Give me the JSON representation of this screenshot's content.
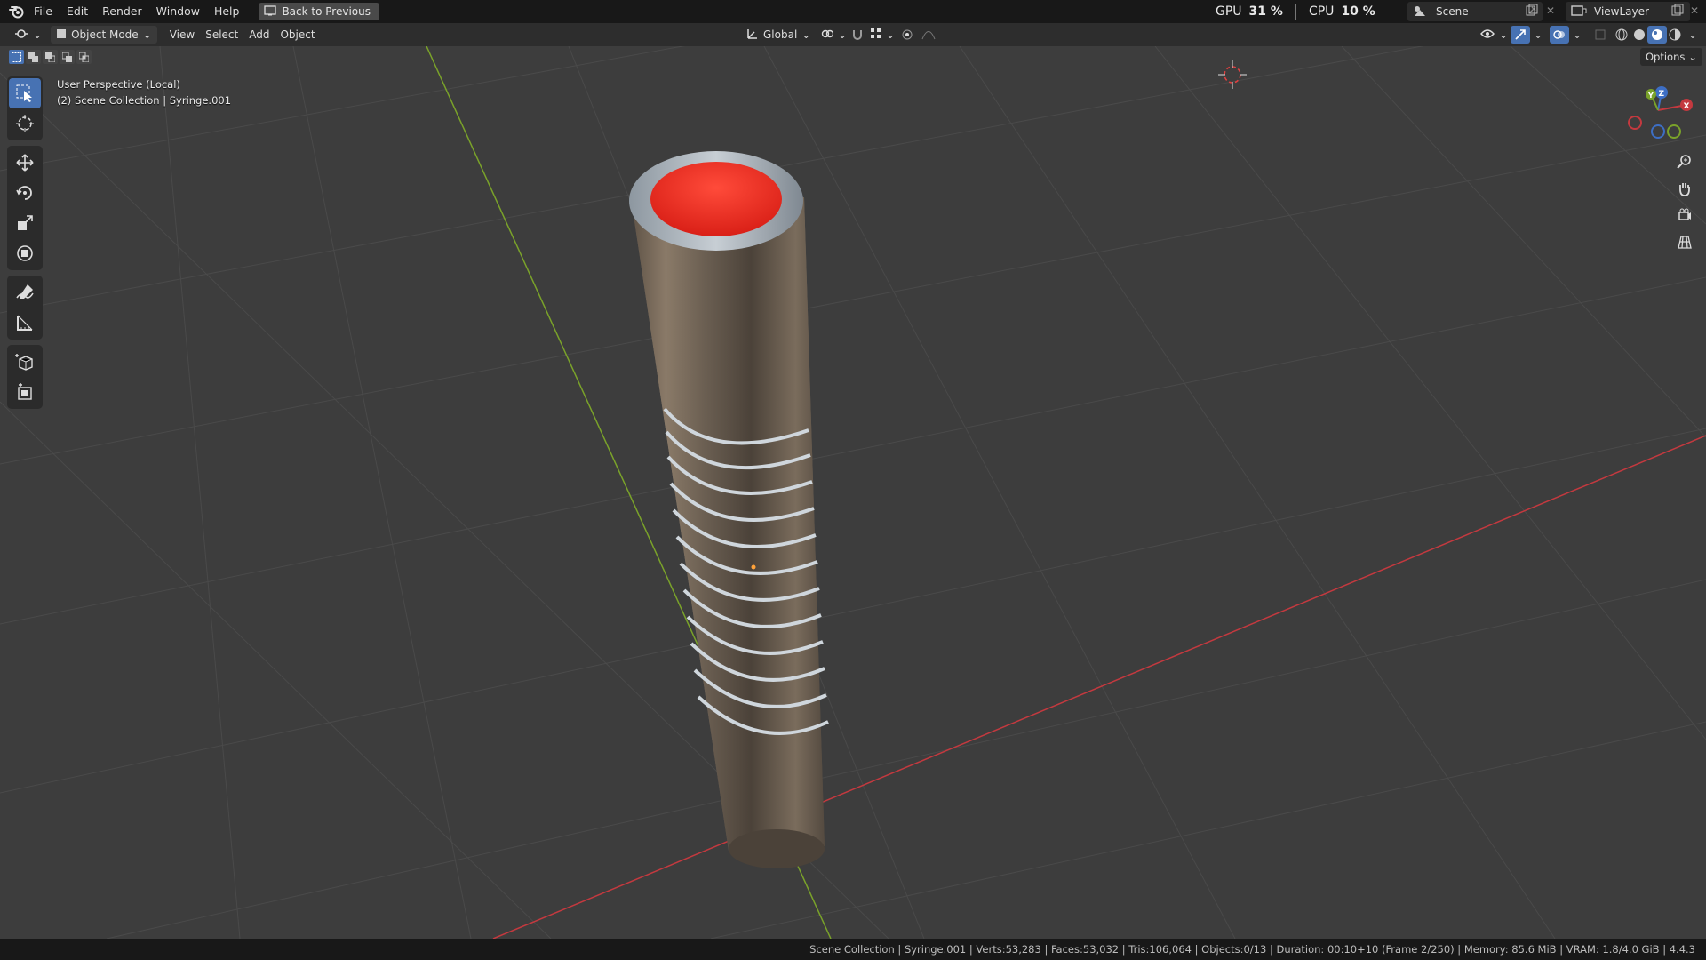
{
  "menu": {
    "items": [
      "File",
      "Edit",
      "Render",
      "Window",
      "Help"
    ],
    "back_button": "Back to Previous"
  },
  "perf": {
    "gpu_label": "GPU",
    "gpu_value": "31 %",
    "cpu_label": "CPU",
    "cpu_value": "10 %"
  },
  "scene": {
    "name": "Scene",
    "view_layer": "ViewLayer"
  },
  "header": {
    "mode": "Object Mode",
    "menus": [
      "View",
      "Select",
      "Add",
      "Object"
    ],
    "transform_orientation": "Global",
    "options_label": "Options"
  },
  "overlay": {
    "perspective": "User Perspective (Local)",
    "collection": "(2) Scene Collection | Syringe.001"
  },
  "gizmo": {
    "x": "X",
    "y": "Y",
    "z": "Z"
  },
  "status": "Scene Collection | Syringe.001 | Verts:53,283 | Faces:53,032 | Tris:106,064 | Objects:0/13 | Duration: 00:10+10 (Frame 2/250) | Memory: 85.6 MiB | VRAM: 1.8/4.0 GiB | 4.4.3",
  "colors": {
    "accent": "#4772b3",
    "x_axis": "#c4393f",
    "y_axis": "#7aa22a",
    "inner_tube": "#e8251d"
  }
}
